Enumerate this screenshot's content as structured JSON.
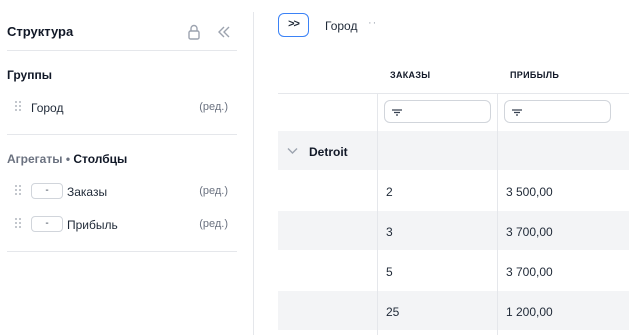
{
  "sidebar": {
    "title": "Структура",
    "groups_title": "Группы",
    "groups": [
      {
        "label": "Город",
        "edit": "(ред.)"
      }
    ],
    "aggregates_title": "Агрегаты",
    "aggregates_separator": "•",
    "aggregates_columns_title": "Столбцы",
    "aggregates": [
      {
        "func": "-",
        "label": "Заказы",
        "edit": "(ред.)"
      },
      {
        "func": "-",
        "label": "Прибыль",
        "edit": "(ред.)"
      }
    ]
  },
  "toolbar": {
    "expand_label": ">>",
    "breadcrumb": "Город",
    "more": "··"
  },
  "table": {
    "columns": [
      "ЗАКАЗЫ",
      "ПРИБЫЛЬ"
    ],
    "group": "Detroit",
    "rows": [
      {
        "orders": "2",
        "profit": "3 500,00"
      },
      {
        "orders": "3",
        "profit": "3 700,00"
      },
      {
        "orders": "5",
        "profit": "3 700,00"
      },
      {
        "orders": "25",
        "profit": "1 200,00"
      }
    ]
  }
}
